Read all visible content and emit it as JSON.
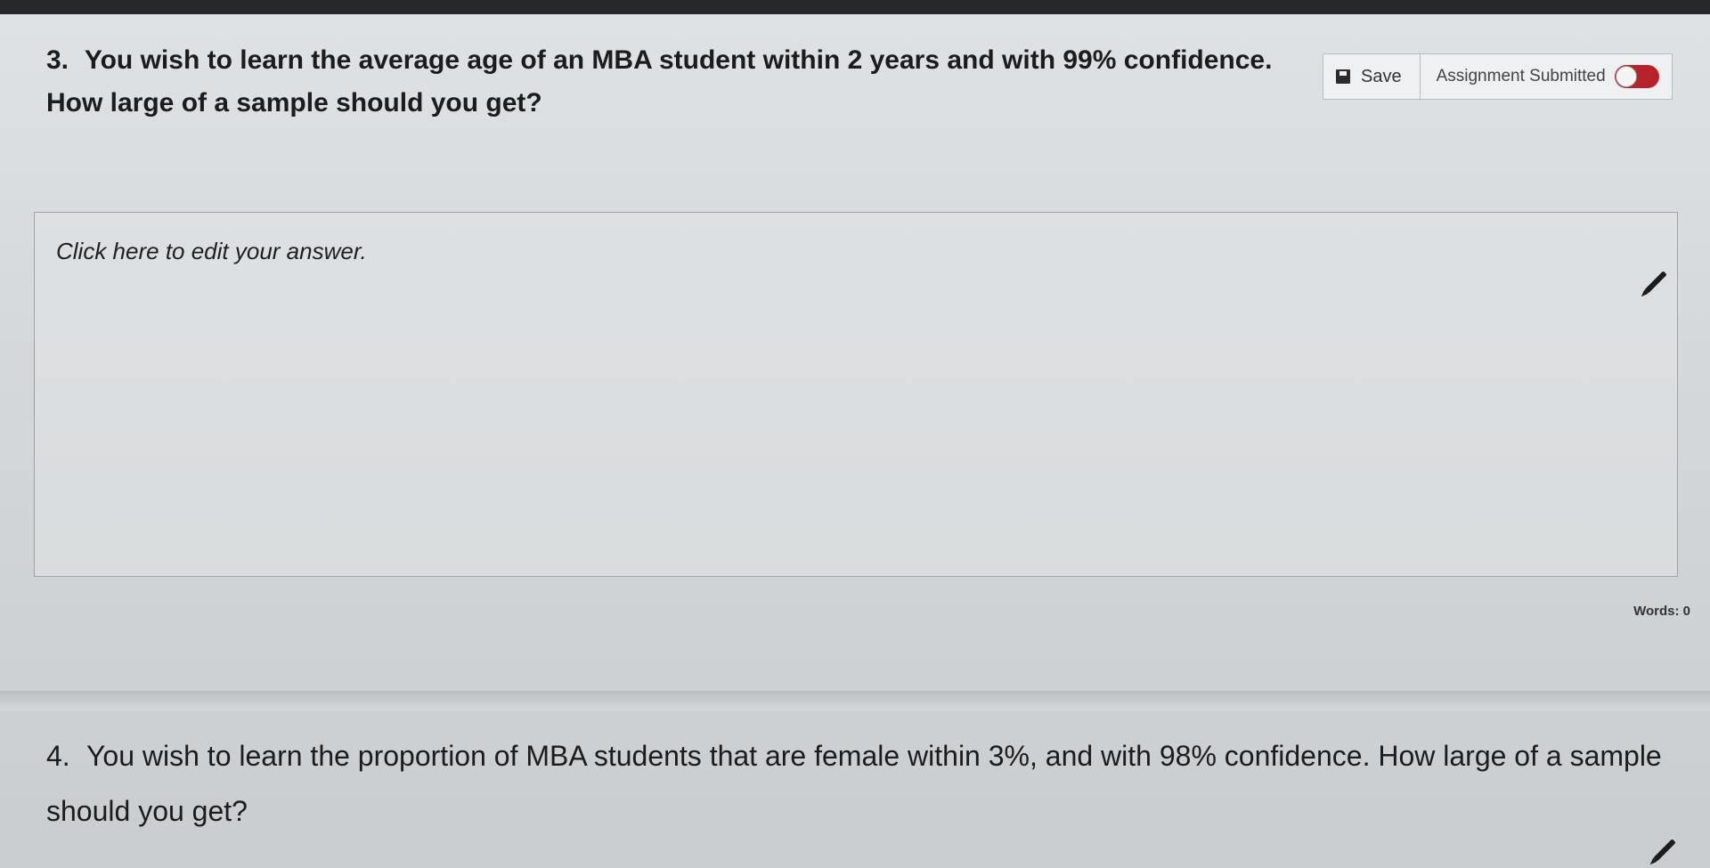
{
  "toolbar": {
    "save_label": "Save",
    "status_label": "Assignment Submitted"
  },
  "questions": [
    {
      "number": "3.",
      "text": "You wish to learn the average age of an MBA student within 2 years and with 99% confidence. How large of a sample should you get?"
    },
    {
      "number": "4.",
      "text": "You wish to learn the proportion of MBA students that are female within 3%, and with 98% confidence. How large of a sample should you get?"
    }
  ],
  "answer": {
    "prompt": "Click here to edit your answer.",
    "word_count": "Words: 0"
  },
  "colors": {
    "toggle_on": "#b8222a",
    "topbar": "#26282a"
  },
  "icons": [
    "save-icon",
    "pencil-icon"
  ]
}
